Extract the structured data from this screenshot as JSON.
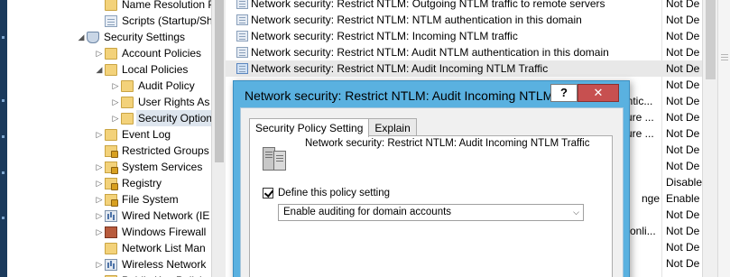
{
  "tree": {
    "items": [
      {
        "label": "Name Resolution Poli",
        "icon": "folder-icon",
        "expander": "",
        "indent": 2
      },
      {
        "label": "Scripts (Startup/Shutd",
        "icon": "doc-icon",
        "expander": "",
        "indent": 2
      },
      {
        "label": "Security Settings",
        "icon": "shield-icon",
        "expander": "◢",
        "indent": 1
      },
      {
        "label": "Account Policies",
        "icon": "folder-icon",
        "expander": "▷",
        "indent": 2
      },
      {
        "label": "Local Policies",
        "icon": "folder-icon",
        "expander": "◢",
        "indent": 2
      },
      {
        "label": "Audit Policy",
        "icon": "folder-icon",
        "expander": "▷",
        "indent": 3
      },
      {
        "label": "User Rights As",
        "icon": "folder-icon",
        "expander": "▷",
        "indent": 3
      },
      {
        "label": "Security Option",
        "icon": "folder-icon",
        "expander": "▷",
        "indent": 3,
        "selected": true
      },
      {
        "label": "Event Log",
        "icon": "folder-icon",
        "expander": "▷",
        "indent": 2
      },
      {
        "label": "Restricted Groups",
        "icon": "folder-lock-icon",
        "expander": "",
        "indent": 2
      },
      {
        "label": "System Services",
        "icon": "folder-lock-icon",
        "expander": "▷",
        "indent": 2
      },
      {
        "label": "Registry",
        "icon": "folder-lock-icon",
        "expander": "▷",
        "indent": 2
      },
      {
        "label": "File System",
        "icon": "folder-lock-icon",
        "expander": "▷",
        "indent": 2
      },
      {
        "label": "Wired Network (IE",
        "icon": "bars-icon",
        "expander": "▷",
        "indent": 2
      },
      {
        "label": "Windows Firewall",
        "icon": "firewall-icon",
        "expander": "▷",
        "indent": 2
      },
      {
        "label": "Network List Man",
        "icon": "folder-icon",
        "expander": "",
        "indent": 2
      },
      {
        "label": "Wireless Network",
        "icon": "bars-icon",
        "expander": "▷",
        "indent": 2
      },
      {
        "label": "Public Key Policie",
        "icon": "folder-icon",
        "expander": "▷",
        "indent": 2
      }
    ]
  },
  "list": {
    "rows": [
      {
        "policy": "Network security: Restrict NTLM: Outgoing NTLM traffic to remote servers",
        "setting": "Not De"
      },
      {
        "policy": "Network security: Restrict NTLM: NTLM authentication in this domain",
        "setting": "Not De"
      },
      {
        "policy": "Network security: Restrict NTLM: Incoming NTLM traffic",
        "setting": "Not De"
      },
      {
        "policy": "Network security: Restrict NTLM: Audit NTLM authentication in this domain",
        "setting": "Not De"
      },
      {
        "policy": "Network security: Restrict NTLM: Audit Incoming NTLM Traffic",
        "setting": "Not De",
        "selected": true
      },
      {
        "policy": "",
        "setting": "Not De"
      },
      {
        "policy": "entic...",
        "setting": "Not De"
      },
      {
        "policy": "cure ...",
        "setting": "Not De"
      },
      {
        "policy": "cure ...",
        "setting": "Not De"
      },
      {
        "policy": "",
        "setting": "Not De"
      },
      {
        "policy": "",
        "setting": "Not De"
      },
      {
        "policy": "",
        "setting": "Disable"
      },
      {
        "policy": "nge",
        "setting": "Enable"
      },
      {
        "policy": "",
        "setting": "Not De"
      },
      {
        "policy": "e onli...",
        "setting": "Not De"
      },
      {
        "policy": "",
        "setting": "Not De"
      },
      {
        "policy": "",
        "setting": "Not De"
      }
    ]
  },
  "dialog": {
    "title": "Network security: Restrict NTLM: Audit Incoming NTLM Traffic",
    "help_label": "?",
    "close_label": "✕",
    "tabs": [
      "Security Policy Setting",
      "Explain"
    ],
    "policy_name": "Network security: Restrict NTLM: Audit Incoming NTLM Traffic",
    "define_label": "Define this policy setting",
    "define_checked": true,
    "selected_option": "Enable auditing for domain accounts"
  },
  "colors": {
    "dialog_frame": "#5ab1e0",
    "close_button": "#c75050",
    "selection": "#e8e8e8"
  }
}
